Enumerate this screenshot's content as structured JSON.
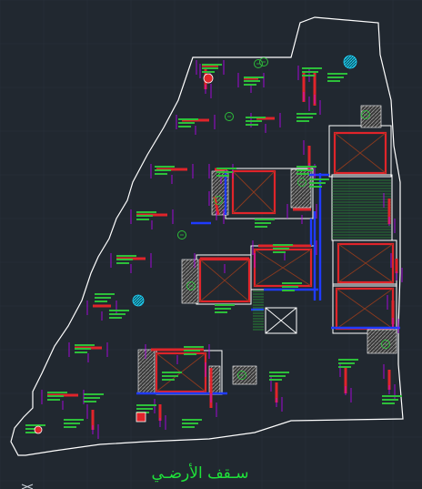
{
  "drawing": {
    "caption": "سـقف الأرضـي",
    "colors": {
      "background": "#212830",
      "grid": "#2b333c",
      "outline": "#ffffff",
      "walls": "#e0242a",
      "dimension": "#2dbf3a",
      "leader": "#c000ff",
      "column_hatch": "#9a9a9a",
      "beam": "#1f3bff",
      "opening": "#8b3a1e",
      "callout": "#22d7ff",
      "caption": "#1fe23a"
    },
    "icons": [
      "circle-marker-icon",
      "cyan-hatched-circle-icon",
      "crosshair-icon"
    ]
  }
}
